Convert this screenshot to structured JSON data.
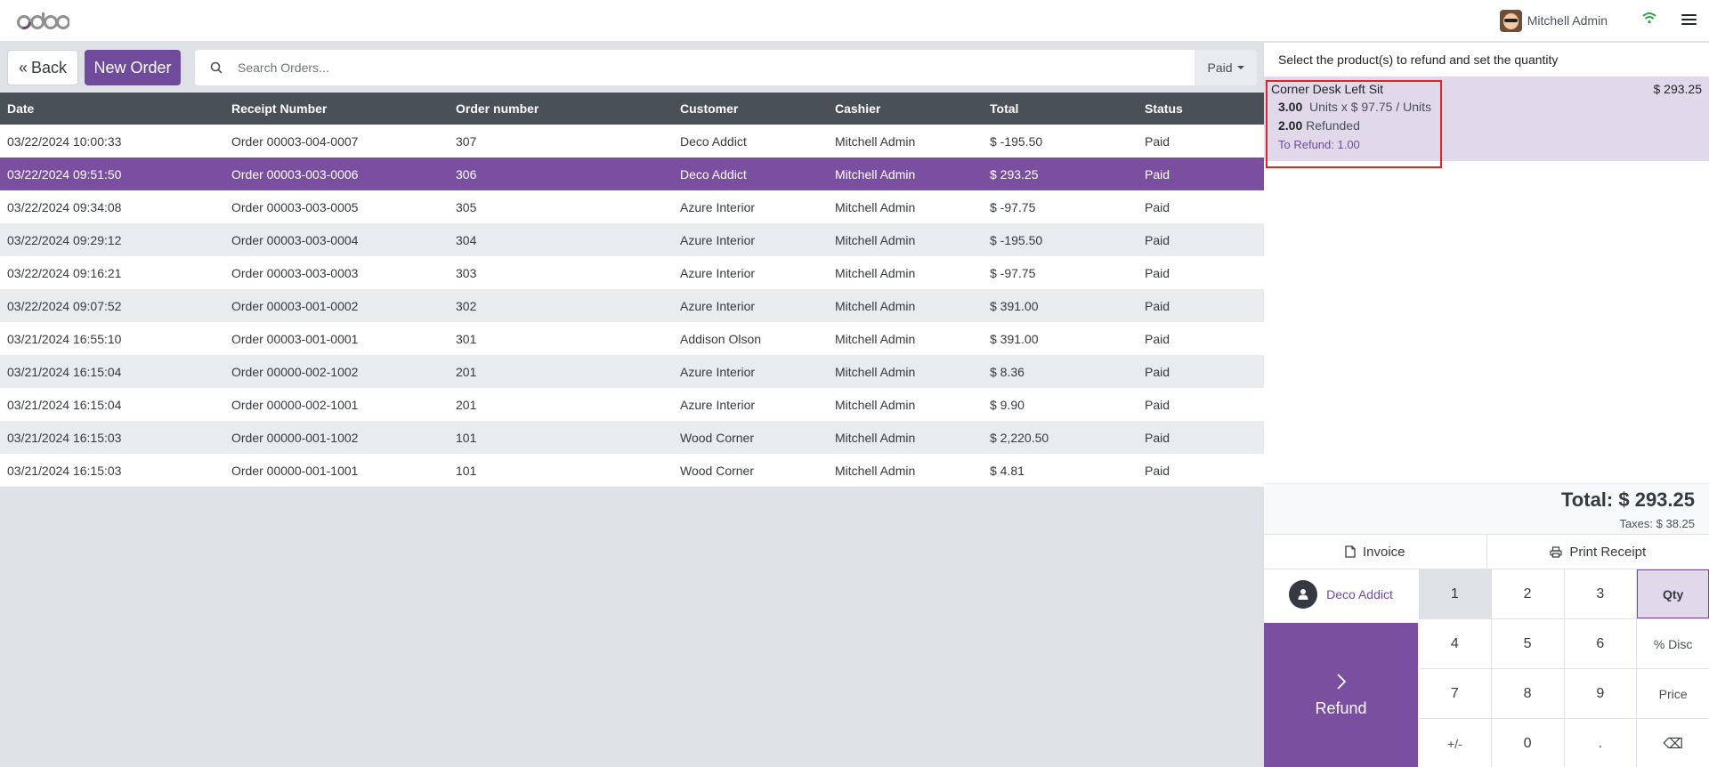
{
  "app": {
    "logo": "odoo"
  },
  "navbar": {
    "user_name": "Mitchell Admin"
  },
  "controls": {
    "back_label": "Back",
    "new_order_label": "New Order",
    "search_placeholder": "Search Orders...",
    "filter_label": "Paid"
  },
  "table": {
    "headers": [
      "Date",
      "Receipt Number",
      "Order number",
      "Customer",
      "Cashier",
      "Total",
      "Status"
    ],
    "rows": [
      {
        "date": "03/22/2024 10:00:33",
        "receipt": "Order 00003-004-0007",
        "order": "307",
        "customer": "Deco Addict",
        "cashier": "Mitchell Admin",
        "total": "$ -195.50",
        "status": "Paid"
      },
      {
        "date": "03/22/2024 09:51:50",
        "receipt": "Order 00003-003-0006",
        "order": "306",
        "customer": "Deco Addict",
        "cashier": "Mitchell Admin",
        "total": "$ 293.25",
        "status": "Paid"
      },
      {
        "date": "03/22/2024 09:34:08",
        "receipt": "Order 00003-003-0005",
        "order": "305",
        "customer": "Azure Interior",
        "cashier": "Mitchell Admin",
        "total": "$ -97.75",
        "status": "Paid"
      },
      {
        "date": "03/22/2024 09:29:12",
        "receipt": "Order 00003-003-0004",
        "order": "304",
        "customer": "Azure Interior",
        "cashier": "Mitchell Admin",
        "total": "$ -195.50",
        "status": "Paid"
      },
      {
        "date": "03/22/2024 09:16:21",
        "receipt": "Order 00003-003-0003",
        "order": "303",
        "customer": "Azure Interior",
        "cashier": "Mitchell Admin",
        "total": "$ -97.75",
        "status": "Paid"
      },
      {
        "date": "03/22/2024 09:07:52",
        "receipt": "Order 00003-001-0002",
        "order": "302",
        "customer": "Azure Interior",
        "cashier": "Mitchell Admin",
        "total": "$ 391.00",
        "status": "Paid"
      },
      {
        "date": "03/21/2024 16:55:10",
        "receipt": "Order 00003-001-0001",
        "order": "301",
        "customer": "Addison Olson",
        "cashier": "Mitchell Admin",
        "total": "$ 391.00",
        "status": "Paid"
      },
      {
        "date": "03/21/2024 16:15:04",
        "receipt": "Order 00000-002-1002",
        "order": "201",
        "customer": "Azure Interior",
        "cashier": "Mitchell Admin",
        "total": "$ 8.36",
        "status": "Paid"
      },
      {
        "date": "03/21/2024 16:15:04",
        "receipt": "Order 00000-002-1001",
        "order": "201",
        "customer": "Azure Interior",
        "cashier": "Mitchell Admin",
        "total": "$ 9.90",
        "status": "Paid"
      },
      {
        "date": "03/21/2024 16:15:03",
        "receipt": "Order 00000-001-1002",
        "order": "101",
        "customer": "Wood Corner",
        "cashier": "Mitchell Admin",
        "total": "$ 2,220.50",
        "status": "Paid"
      },
      {
        "date": "03/21/2024 16:15:03",
        "receipt": "Order 00000-001-1001",
        "order": "101",
        "customer": "Wood Corner",
        "cashier": "Mitchell Admin",
        "total": "$ 4.81",
        "status": "Paid"
      }
    ]
  },
  "refund_panel": {
    "header": "Select the product(s) to refund and set the quantity",
    "line": {
      "product": "Corner Desk Left Sit",
      "price": "$ 293.25",
      "qty": "3.00",
      "unit_text": "Units x $ 97.75 / Units",
      "refunded_qty": "2.00",
      "refunded_text": "Refunded",
      "to_refund": "To Refund: 1.00"
    },
    "total": "Total: $ 293.25",
    "taxes": "Taxes: $ 38.25",
    "invoice_label": "Invoice",
    "print_label": "Print Receipt",
    "customer": "Deco Addict",
    "refund_label": "Refund"
  },
  "numpad": {
    "keys": [
      "1",
      "2",
      "3",
      "Qty",
      "4",
      "5",
      "6",
      "% Disc",
      "7",
      "8",
      "9",
      "Price",
      "+/-",
      "0",
      ".",
      "⌫"
    ]
  },
  "colors": {
    "brand": "#714b9b",
    "selected_row": "#7a4f9f",
    "table_header": "#495057",
    "highlight_box": "#e02424"
  }
}
